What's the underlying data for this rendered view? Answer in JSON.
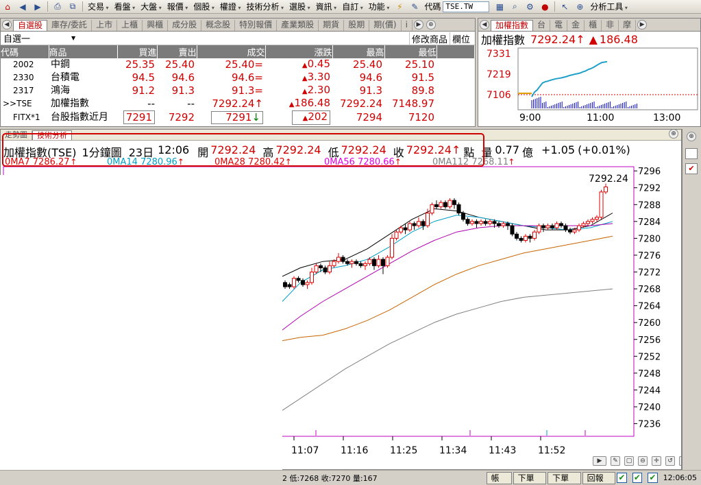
{
  "toolbar": {
    "menus": [
      "交易",
      "看盤",
      "大盤",
      "報價",
      "個股",
      "權證",
      "技術分析",
      "選股",
      "資訊",
      "自訂",
      "功能"
    ],
    "code_label": "代碼",
    "code_value": "TSE.TW",
    "tools_menu": "分析工具"
  },
  "quote_panel": {
    "tabs": [
      "自選股",
      "庫存/委託",
      "上市",
      "上櫃",
      "興櫃",
      "成分股",
      "概念股",
      "特別報價",
      "產業類股",
      "期貨",
      "股期",
      "期(價)",
      "i"
    ],
    "watchlist": "自選一",
    "actions": [
      "修改商品",
      "欄位"
    ],
    "columns": [
      "代碼",
      "商品",
      "買進",
      "賣出",
      "成交",
      "漲跌",
      "最高",
      "最低"
    ],
    "rows": [
      {
        "code": "2002",
        "name": "中鋼",
        "bid": "25.35",
        "ask": "25.40",
        "last": "25.40",
        "flag": "=",
        "change": "0.45",
        "high": "25.40",
        "low": "25.10"
      },
      {
        "code": "2330",
        "name": "台積電",
        "bid": "94.5",
        "ask": "94.6",
        "last": "94.6",
        "flag": "=",
        "change": "3.30",
        "high": "94.6",
        "low": "91.5"
      },
      {
        "code": "2317",
        "name": "鴻海",
        "bid": "91.2",
        "ask": "91.3",
        "last": "91.3",
        "flag": "=",
        "change": "2.30",
        "high": "91.3",
        "low": "89.8"
      },
      {
        "code": ">>TSE",
        "name": "加權指數",
        "bid": "--",
        "ask": "--",
        "last": "7292.24",
        "flag": "↑",
        "change": "186.48",
        "high": "7292.24",
        "low": "7148.97"
      },
      {
        "code": "FITX*1",
        "name": "台股指數近月",
        "bid": "7291",
        "ask": "7292",
        "last": "7291",
        "flag": "↓",
        "change": "202",
        "high": "7294",
        "low": "7120"
      }
    ]
  },
  "index_panel": {
    "tabs": [
      "加權指數",
      "台",
      "電",
      "金",
      "櫃",
      "非",
      "摩"
    ],
    "title": "加權指數",
    "value": "7292.24",
    "change": "186.48",
    "y_ticks": [
      "7331",
      "7219",
      "7106"
    ],
    "x_ticks": [
      "9:00",
      "11:00",
      "13:00"
    ]
  },
  "chart_panel": {
    "tabs": [
      "走勢圖",
      "技術分析"
    ],
    "header": {
      "name": "加權指數(TSE)",
      "period": "1分鐘圖",
      "date": "23日",
      "time": "12:06",
      "open_label": "開",
      "open": "7292.24",
      "high_label": "高",
      "high": "7292.24",
      "low_label": "低",
      "low": "7292.24",
      "close_label": "收",
      "close": "7292.24",
      "unit": "點",
      "vol_label": "量",
      "vol": "0.77",
      "vol_unit": "億",
      "change": "+1.05",
      "pct": "(+0.01%)"
    },
    "ma_labels": [
      "0MA7 7286.27",
      "0MA14 7280.96",
      "0MA28 7280.42",
      "0MA56 7280.66",
      "0MA112 7268.11"
    ],
    "last_price_label": "7292.24"
  },
  "chart_data": {
    "type": "candlestick",
    "y_ticks": [
      7296,
      7292,
      7288,
      7284,
      7280,
      7276,
      7272,
      7268,
      7264,
      7260,
      7256,
      7252,
      7248,
      7244,
      7240,
      7236
    ],
    "ylim": [
      7233,
      7297
    ],
    "x_ticks": [
      "11:07",
      "11:16",
      "11:25",
      "11:34",
      "11:43",
      "11:52"
    ],
    "candles": [
      [
        7269.5,
        7268.5,
        7270.0,
        7268.0
      ],
      [
        7269.0,
        7268.5,
        7269.5,
        7268.0
      ],
      [
        7268.5,
        7270.5,
        7271.0,
        7268.0
      ],
      [
        7270.5,
        7270.0,
        7271.0,
        7269.5
      ],
      [
        7270.0,
        7269.0,
        7270.5,
        7268.5
      ],
      [
        7269.0,
        7269.5,
        7270.0,
        7268.0
      ],
      [
        7269.5,
        7272.0,
        7273.0,
        7269.0
      ],
      [
        7272.0,
        7273.5,
        7274.0,
        7271.5
      ],
      [
        7273.5,
        7273.0,
        7274.0,
        7272.0
      ],
      [
        7273.0,
        7272.0,
        7273.5,
        7271.5
      ],
      [
        7272.0,
        7273.5,
        7274.5,
        7271.5
      ],
      [
        7273.5,
        7274.5,
        7275.0,
        7273.0
      ],
      [
        7274.5,
        7275.5,
        7276.5,
        7274.0
      ],
      [
        7275.5,
        7274.5,
        7276.0,
        7274.0
      ],
      [
        7274.5,
        7274.0,
        7275.0,
        7273.5
      ],
      [
        7274.0,
        7274.5,
        7275.0,
        7273.0
      ],
      [
        7274.5,
        7274.0,
        7275.0,
        7273.5
      ],
      [
        7274.0,
        7273.5,
        7274.5,
        7273.0
      ],
      [
        7273.5,
        7274.0,
        7274.5,
        7272.5
      ],
      [
        7274.0,
        7275.0,
        7275.5,
        7273.5
      ],
      [
        7275.0,
        7273.5,
        7275.5,
        7272.5
      ],
      [
        7273.5,
        7275.0,
        7276.0,
        7273.0
      ],
      [
        7275.0,
        7273.5,
        7275.5,
        7271.5
      ],
      [
        7273.5,
        7275.5,
        7276.0,
        7273.0
      ],
      [
        7275.5,
        7280.0,
        7281.0,
        7275.0
      ],
      [
        7280.0,
        7281.5,
        7282.0,
        7279.5
      ],
      [
        7281.5,
        7282.5,
        7283.0,
        7281.0
      ],
      [
        7282.5,
        7282.0,
        7283.5,
        7281.0
      ],
      [
        7282.0,
        7283.5,
        7284.0,
        7281.5
      ],
      [
        7283.5,
        7283.0,
        7284.0,
        7282.0
      ],
      [
        7283.0,
        7284.0,
        7285.0,
        7282.5
      ],
      [
        7284.0,
        7283.0,
        7284.5,
        7282.0
      ],
      [
        7283.0,
        7286.0,
        7287.0,
        7282.5
      ],
      [
        7286.0,
        7288.0,
        7288.5,
        7285.5
      ],
      [
        7288.0,
        7287.5,
        7289.0,
        7287.0
      ],
      [
        7287.5,
        7288.5,
        7289.0,
        7287.0
      ],
      [
        7288.5,
        7287.5,
        7289.0,
        7287.0
      ],
      [
        7287.5,
        7289.0,
        7289.5,
        7287.0
      ],
      [
        7289.0,
        7288.0,
        7289.5,
        7287.0
      ],
      [
        7288.0,
        7286.0,
        7288.5,
        7285.5
      ],
      [
        7286.0,
        7284.5,
        7286.5,
        7284.0
      ],
      [
        7284.5,
        7283.5,
        7285.0,
        7283.0
      ],
      [
        7283.5,
        7284.0,
        7284.5,
        7283.0
      ],
      [
        7284.0,
        7283.5,
        7284.5,
        7282.5
      ],
      [
        7283.5,
        7284.0,
        7284.5,
        7283.0
      ],
      [
        7284.0,
        7283.5,
        7284.5,
        7283.0
      ],
      [
        7283.5,
        7284.0,
        7284.5,
        7283.0
      ],
      [
        7284.0,
        7283.5,
        7284.5,
        7282.5
      ],
      [
        7283.5,
        7283.0,
        7284.0,
        7282.5
      ],
      [
        7283.0,
        7283.5,
        7284.0,
        7282.5
      ],
      [
        7283.5,
        7283.0,
        7284.0,
        7282.0
      ],
      [
        7283.0,
        7281.0,
        7283.5,
        7280.5
      ],
      [
        7281.0,
        7280.0,
        7281.5,
        7279.5
      ],
      [
        7280.0,
        7279.5,
        7280.5,
        7279.0
      ],
      [
        7279.5,
        7280.5,
        7281.0,
        7279.0
      ],
      [
        7280.5,
        7280.0,
        7281.0,
        7279.0
      ],
      [
        7280.0,
        7281.5,
        7282.0,
        7279.5
      ],
      [
        7281.5,
        7283.0,
        7283.5,
        7281.0
      ],
      [
        7283.0,
        7282.5,
        7283.5,
        7281.5
      ],
      [
        7282.5,
        7283.0,
        7283.5,
        7282.0
      ],
      [
        7283.0,
        7282.5,
        7283.5,
        7282.0
      ],
      [
        7282.5,
        7283.5,
        7284.0,
        7282.0
      ],
      [
        7283.5,
        7283.0,
        7284.0,
        7282.5
      ],
      [
        7283.0,
        7282.0,
        7283.5,
        7281.5
      ],
      [
        7282.0,
        7281.5,
        7282.5,
        7281.0
      ],
      [
        7281.5,
        7282.0,
        7282.5,
        7281.0
      ],
      [
        7282.0,
        7283.0,
        7283.5,
        7281.5
      ],
      [
        7283.0,
        7283.5,
        7284.0,
        7282.5
      ],
      [
        7283.5,
        7284.0,
        7284.5,
        7283.0
      ],
      [
        7284.0,
        7284.5,
        7285.0,
        7283.5
      ],
      [
        7284.5,
        7285.0,
        7285.5,
        7284.0
      ],
      [
        7285.0,
        7291.0,
        7291.5,
        7284.5
      ],
      [
        7291.0,
        7292.2,
        7293.0,
        7290.5
      ]
    ],
    "ma_lines": [
      {
        "color": "#000000",
        "values": [
          7270.5,
          7273.0,
          7274.5,
          7275.0,
          7277.5,
          7281.0,
          7284.5,
          7287.0,
          7286.5,
          7285.0,
          7284.0,
          7283.0,
          7282.0,
          7282.0,
          7283.0,
          7286.0
        ]
      },
      {
        "color": "#00a0c8",
        "values": [
          7264.0,
          7269.5,
          7272.5,
          7273.5,
          7275.0,
          7278.0,
          7281.5,
          7284.0,
          7285.5,
          7285.0,
          7284.0,
          7283.0,
          7282.5,
          7282.0,
          7282.5,
          7284.0
        ]
      },
      {
        "color": "#b000b0",
        "values": [
          7257.5,
          7261.5,
          7265.0,
          7268.0,
          7271.0,
          7274.0,
          7277.0,
          7279.5,
          7281.5,
          7282.5,
          7283.0,
          7283.0,
          7283.0,
          7283.0,
          7283.0,
          7283.5
        ]
      },
      {
        "color": "#c86400",
        "values": [
          7255.5,
          7256.5,
          7257.0,
          7258.5,
          7260.5,
          7263.0,
          7266.0,
          7269.0,
          7271.5,
          7273.5,
          7275.0,
          7276.5,
          7277.5,
          7278.5,
          7279.5,
          7280.5
        ]
      },
      {
        "color": "#808080",
        "values": [
          7238.5,
          7242.0,
          7245.5,
          7249.0,
          7252.0,
          7255.0,
          7257.5,
          7260.0,
          7262.0,
          7263.5,
          7265.0,
          7266.0,
          7266.5,
          7267.0,
          7267.5,
          7268.0
        ]
      }
    ]
  },
  "mini_chart": {
    "ylim": [
      7090,
      7345
    ],
    "price_path": [
      7140,
      7160,
      7170,
      7185,
      7200,
      7205,
      7208,
      7212,
      7215,
      7218,
      7220,
      7222,
      7225,
      7228,
      7232,
      7235,
      7238,
      7240,
      7243,
      7248,
      7252,
      7258,
      7262,
      7268,
      7275,
      7282,
      7288,
      7290,
      7292
    ]
  },
  "status_bar": {
    "text": "2 低:7268 收:7270 量:167",
    "buttons": [
      "帳務",
      "下單夾",
      "下單列",
      "回報列"
    ],
    "clock": "12:06:05"
  }
}
